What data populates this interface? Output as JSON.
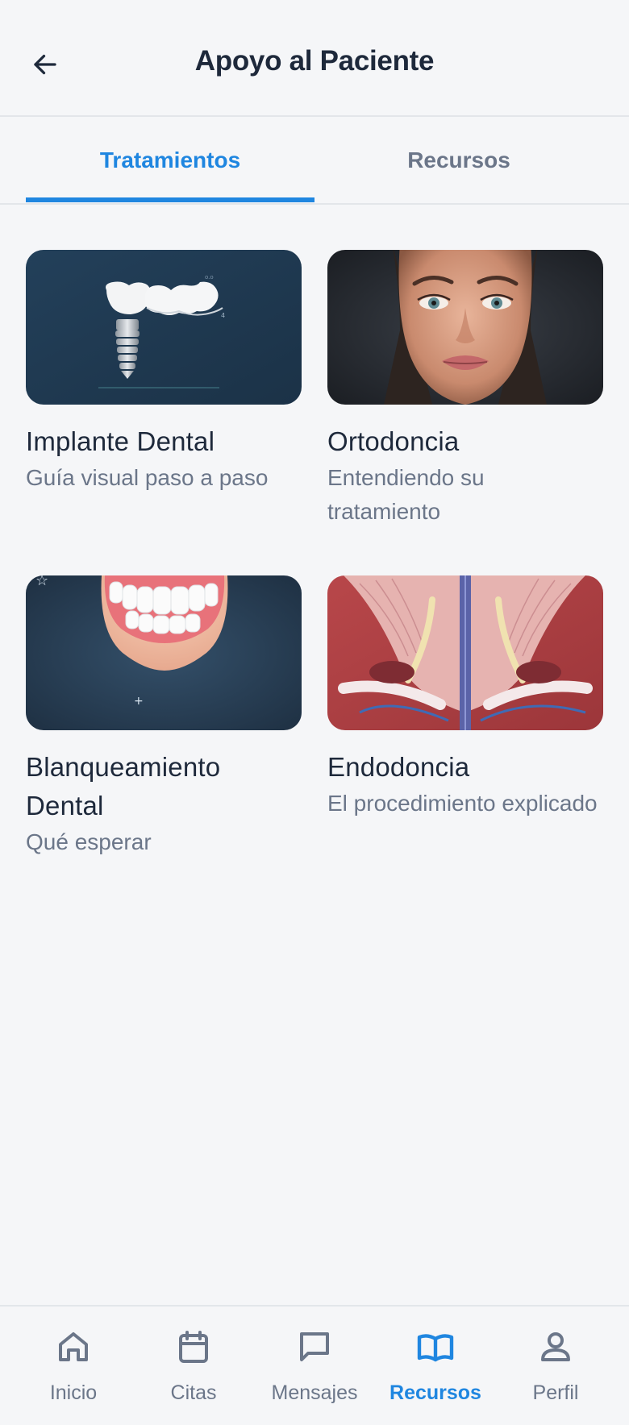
{
  "header": {
    "title": "Apoyo al Paciente",
    "back_icon": "arrow-left-icon"
  },
  "tabs": [
    {
      "label": "Tratamientos",
      "active": true
    },
    {
      "label": "Recursos",
      "active": false
    }
  ],
  "colors": {
    "accent": "#1f86e0",
    "text_primary": "#1e293b",
    "text_secondary": "#6b7689",
    "background": "#f5f6f8"
  },
  "treatments": [
    {
      "title": "Implante Dental",
      "subtitle": "Guía visual paso a paso",
      "image": "dental-implant-illustration"
    },
    {
      "title": "Ortodoncia",
      "subtitle": "Entendiendo su tratamiento",
      "image": "woman-face-portrait"
    },
    {
      "title": "Blanqueamiento Dental",
      "subtitle": "Qué esperar",
      "image": "white-teeth-smile-illustration"
    },
    {
      "title": "Endodoncia",
      "subtitle": "El procedimiento explicado",
      "image": "tooth-root-anatomy-illustration"
    }
  ],
  "bottom_nav": [
    {
      "label": "Inicio",
      "icon": "home-icon",
      "active": false
    },
    {
      "label": "Citas",
      "icon": "calendar-icon",
      "active": false
    },
    {
      "label": "Mensajes",
      "icon": "message-icon",
      "active": false
    },
    {
      "label": "Recursos",
      "icon": "book-open-icon",
      "active": true
    },
    {
      "label": "Perfil",
      "icon": "user-icon",
      "active": false
    }
  ]
}
